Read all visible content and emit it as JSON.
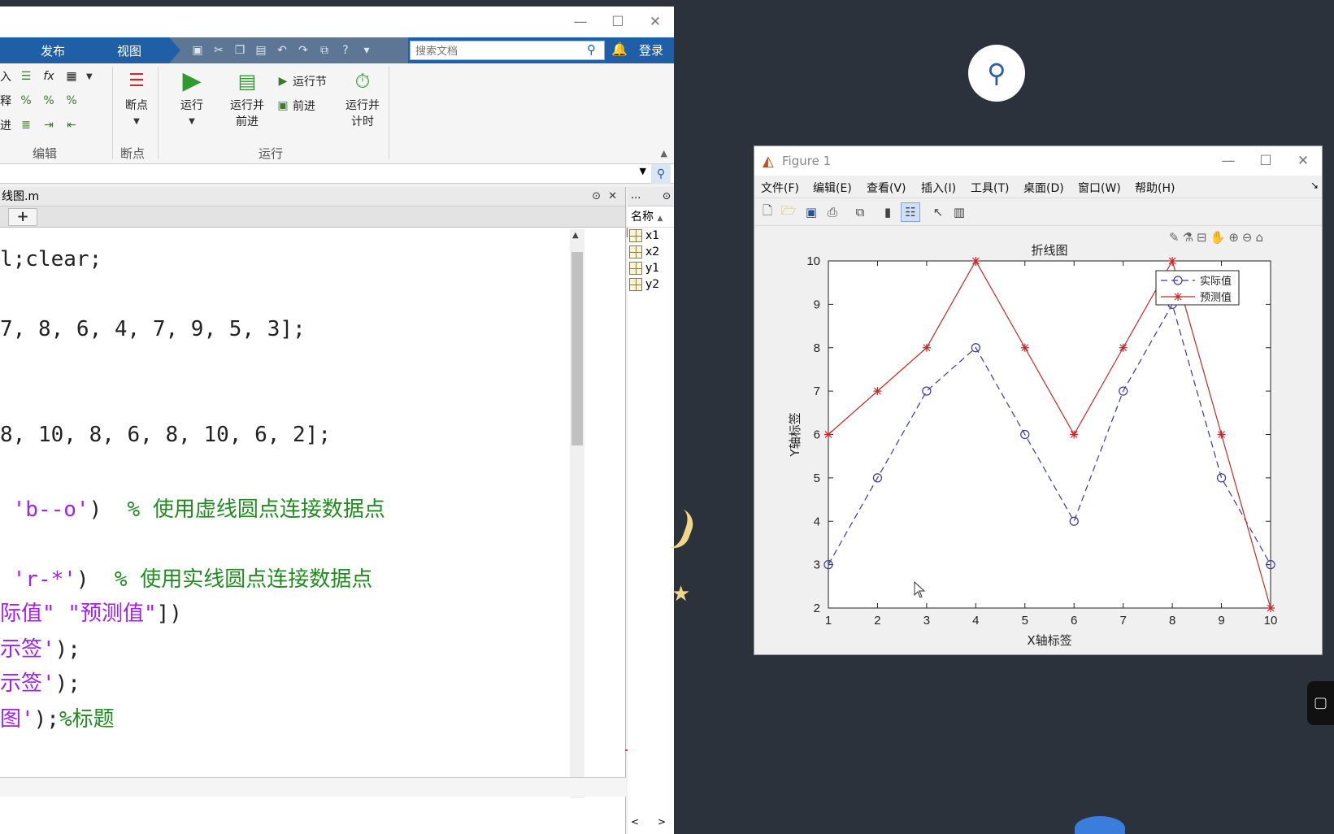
{
  "matlab": {
    "tabs": [
      "发布",
      "视图"
    ],
    "search_placeholder": "搜索文档",
    "login": "登录",
    "edit_group": {
      "rows": [
        "插入",
        "注释",
        "缩进"
      ],
      "label": "编辑"
    },
    "breakpoint_group": {
      "button": "断点",
      "label": "断点"
    },
    "run_group": {
      "run": "运行",
      "run_advance": [
        "运行并",
        "前进"
      ],
      "run_section": "运行节",
      "advance": "前进",
      "run_time": [
        "运行并",
        "计时"
      ],
      "label": "运行"
    },
    "editor_tab_file": "线图.m",
    "code_lines": [
      {
        "parts": [
          {
            "t": "k",
            "v": "l;clear;"
          }
        ]
      },
      {
        "parts": [
          {
            "t": "k",
            "v": "7, 8, 6, 4, 7, 9, 5, 3];"
          }
        ]
      },
      {
        "parts": [
          {
            "t": "k",
            "v": "8, 10, 8, 6, 8, 10, 6, 2];"
          }
        ]
      },
      {
        "parts": [
          {
            "t": "s",
            "v": " 'b--o'"
          },
          {
            "t": "k",
            "v": ")  "
          },
          {
            "t": "c",
            "v": "% 使用虚线圆点连接数据点"
          }
        ]
      },
      {
        "parts": [
          {
            "t": "s",
            "v": " 'r-*'"
          },
          {
            "t": "k",
            "v": ")  "
          },
          {
            "t": "c",
            "v": "% 使用实线圆点连接数据点"
          }
        ]
      },
      {
        "parts": [
          {
            "t": "s",
            "v": "际值\" \"预测值\""
          },
          {
            "t": "k",
            "v": "])"
          }
        ]
      },
      {
        "parts": [
          {
            "t": "s",
            "v": "示签'"
          },
          {
            "t": "k",
            "v": ");"
          }
        ]
      },
      {
        "parts": [
          {
            "t": "s",
            "v": "示签'"
          },
          {
            "t": "k",
            "v": ");"
          }
        ]
      },
      {
        "parts": [
          {
            "t": "s",
            "v": "图'"
          },
          {
            "t": "k",
            "v": ");"
          },
          {
            "t": "c",
            "v": "%标题"
          }
        ]
      }
    ],
    "workspace": {
      "header": "...",
      "column": "名称",
      "vars": [
        "x1",
        "x2",
        "y1",
        "y2"
      ]
    }
  },
  "figure": {
    "title": "Figure 1",
    "menu": [
      "文件(F)",
      "编辑(E)",
      "查看(V)",
      "插入(I)",
      "工具(T)",
      "桌面(D)",
      "窗口(W)",
      "帮助(H)"
    ]
  },
  "chart_data": {
    "type": "line",
    "title": "折线图",
    "xlabel": "X轴标签",
    "ylabel": "Y轴标签",
    "xlim": [
      1,
      10
    ],
    "ylim": [
      2,
      10
    ],
    "x": [
      1,
      2,
      3,
      4,
      5,
      6,
      7,
      8,
      9,
      10
    ],
    "xticks": [
      1,
      2,
      3,
      4,
      5,
      6,
      7,
      8,
      9,
      10
    ],
    "yticks": [
      2,
      3,
      4,
      5,
      6,
      7,
      8,
      9,
      10
    ],
    "legend_position": "top-right",
    "series": [
      {
        "name": "实际值",
        "values": [
          3,
          5,
          7,
          8,
          6,
          4,
          7,
          9,
          5,
          3
        ],
        "color": "#3a3aa0",
        "style": "dashed",
        "marker": "circle"
      },
      {
        "name": "预测值",
        "values": [
          6,
          7,
          8,
          10,
          8,
          6,
          8,
          10,
          6,
          2
        ],
        "color": "#c62828",
        "style": "solid",
        "marker": "star"
      }
    ]
  }
}
